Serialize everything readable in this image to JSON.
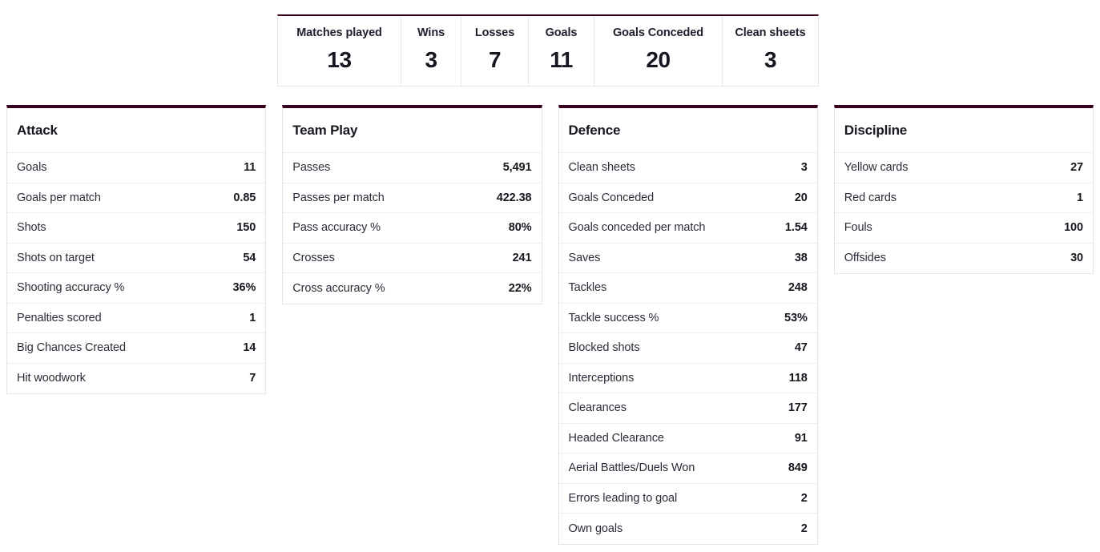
{
  "theme": {
    "accent": "#37001f",
    "border": "#e5e5e5",
    "row_divider": "#ededed",
    "label_color": "#2c2c3a",
    "value_color": "#17171f",
    "background": "#ffffff"
  },
  "summary": {
    "cells": [
      {
        "label": "Matches played",
        "value": "13"
      },
      {
        "label": "Wins",
        "value": "3"
      },
      {
        "label": "Losses",
        "value": "7"
      },
      {
        "label": "Goals",
        "value": "11"
      },
      {
        "label": "Goals Conceded",
        "value": "20"
      },
      {
        "label": "Clean sheets",
        "value": "3"
      }
    ]
  },
  "panels": [
    {
      "title": "Attack",
      "rows": [
        {
          "label": "Goals",
          "value": "11"
        },
        {
          "label": "Goals per match",
          "value": "0.85"
        },
        {
          "label": "Shots",
          "value": "150"
        },
        {
          "label": "Shots on target",
          "value": "54"
        },
        {
          "label": "Shooting accuracy %",
          "value": "36%"
        },
        {
          "label": "Penalties scored",
          "value": "1"
        },
        {
          "label": "Big Chances Created",
          "value": "14"
        },
        {
          "label": "Hit woodwork",
          "value": "7"
        }
      ]
    },
    {
      "title": "Team Play",
      "rows": [
        {
          "label": "Passes",
          "value": "5,491"
        },
        {
          "label": "Passes per match",
          "value": "422.38"
        },
        {
          "label": "Pass accuracy %",
          "value": "80%"
        },
        {
          "label": "Crosses",
          "value": "241"
        },
        {
          "label": "Cross accuracy %",
          "value": "22%"
        }
      ]
    },
    {
      "title": "Defence",
      "rows": [
        {
          "label": "Clean sheets",
          "value": "3"
        },
        {
          "label": "Goals Conceded",
          "value": "20"
        },
        {
          "label": "Goals conceded per match",
          "value": "1.54"
        },
        {
          "label": "Saves",
          "value": "38"
        },
        {
          "label": "Tackles",
          "value": "248"
        },
        {
          "label": "Tackle success %",
          "value": "53%"
        },
        {
          "label": "Blocked shots",
          "value": "47"
        },
        {
          "label": "Interceptions",
          "value": "118"
        },
        {
          "label": "Clearances",
          "value": "177"
        },
        {
          "label": "Headed Clearance",
          "value": "91"
        },
        {
          "label": "Aerial Battles/Duels Won",
          "value": "849"
        },
        {
          "label": "Errors leading to goal",
          "value": "2"
        },
        {
          "label": "Own goals",
          "value": "2"
        }
      ]
    },
    {
      "title": "Discipline",
      "rows": [
        {
          "label": "Yellow cards",
          "value": "27"
        },
        {
          "label": "Red cards",
          "value": "1"
        },
        {
          "label": "Fouls",
          "value": "100"
        },
        {
          "label": "Offsides",
          "value": "30"
        }
      ]
    }
  ]
}
